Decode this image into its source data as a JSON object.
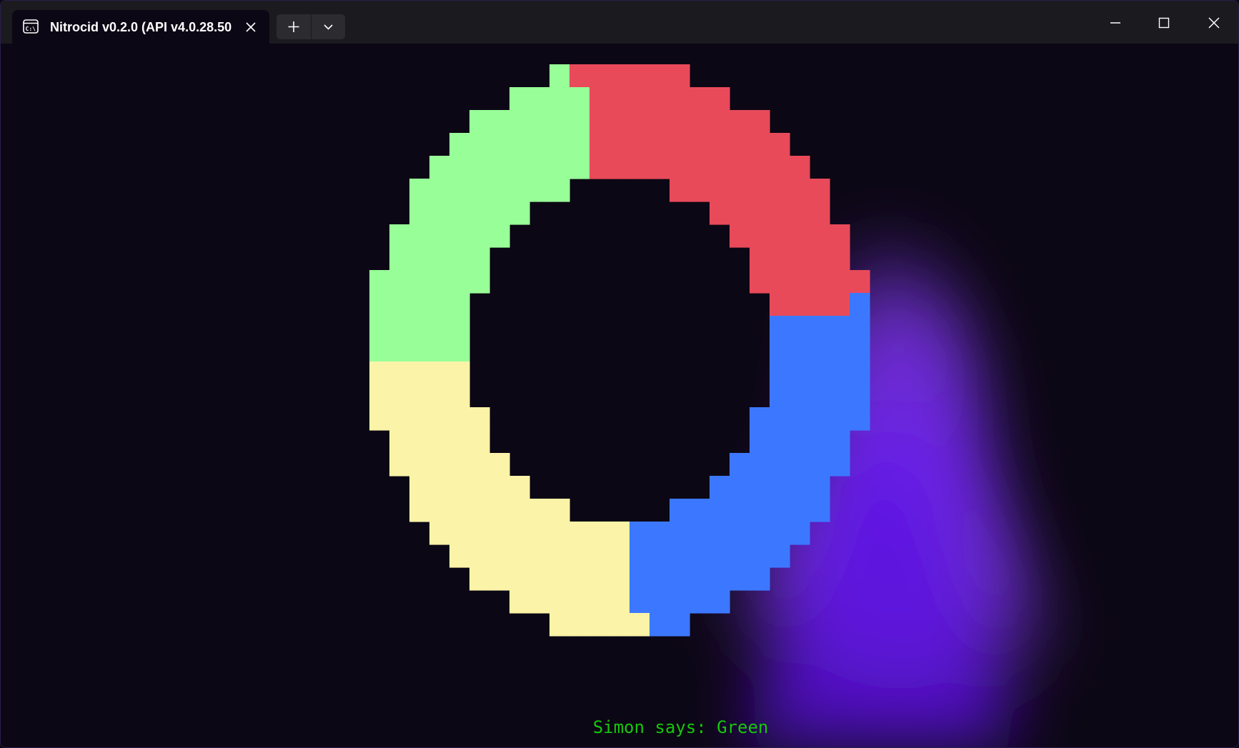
{
  "window": {
    "tab_title": "Nitrocid v0.2.0 (API v4.0.28.50",
    "tab_icon": "terminal-icon",
    "new_tab_icon": "plus-icon",
    "dropdown_icon": "chevron-down-icon",
    "minimize_icon": "minimize-icon",
    "maximize_icon": "maximize-icon",
    "close_icon": "close-icon"
  },
  "game": {
    "status_prefix": "Simon says: ",
    "status_color_name": "Green",
    "status_text_color": "#16c60c",
    "quadrants": [
      {
        "name": "Green",
        "color": "#98ff98"
      },
      {
        "name": "Red",
        "color": "#e84a5a"
      },
      {
        "name": "Blue",
        "color": "#3c78ff"
      },
      {
        "name": "Yellow",
        "color": "#faf3a8"
      }
    ]
  },
  "colors": {
    "background": "#0c0714",
    "titlebar": "#1b1b1f",
    "glow": "#7c3aed"
  }
}
